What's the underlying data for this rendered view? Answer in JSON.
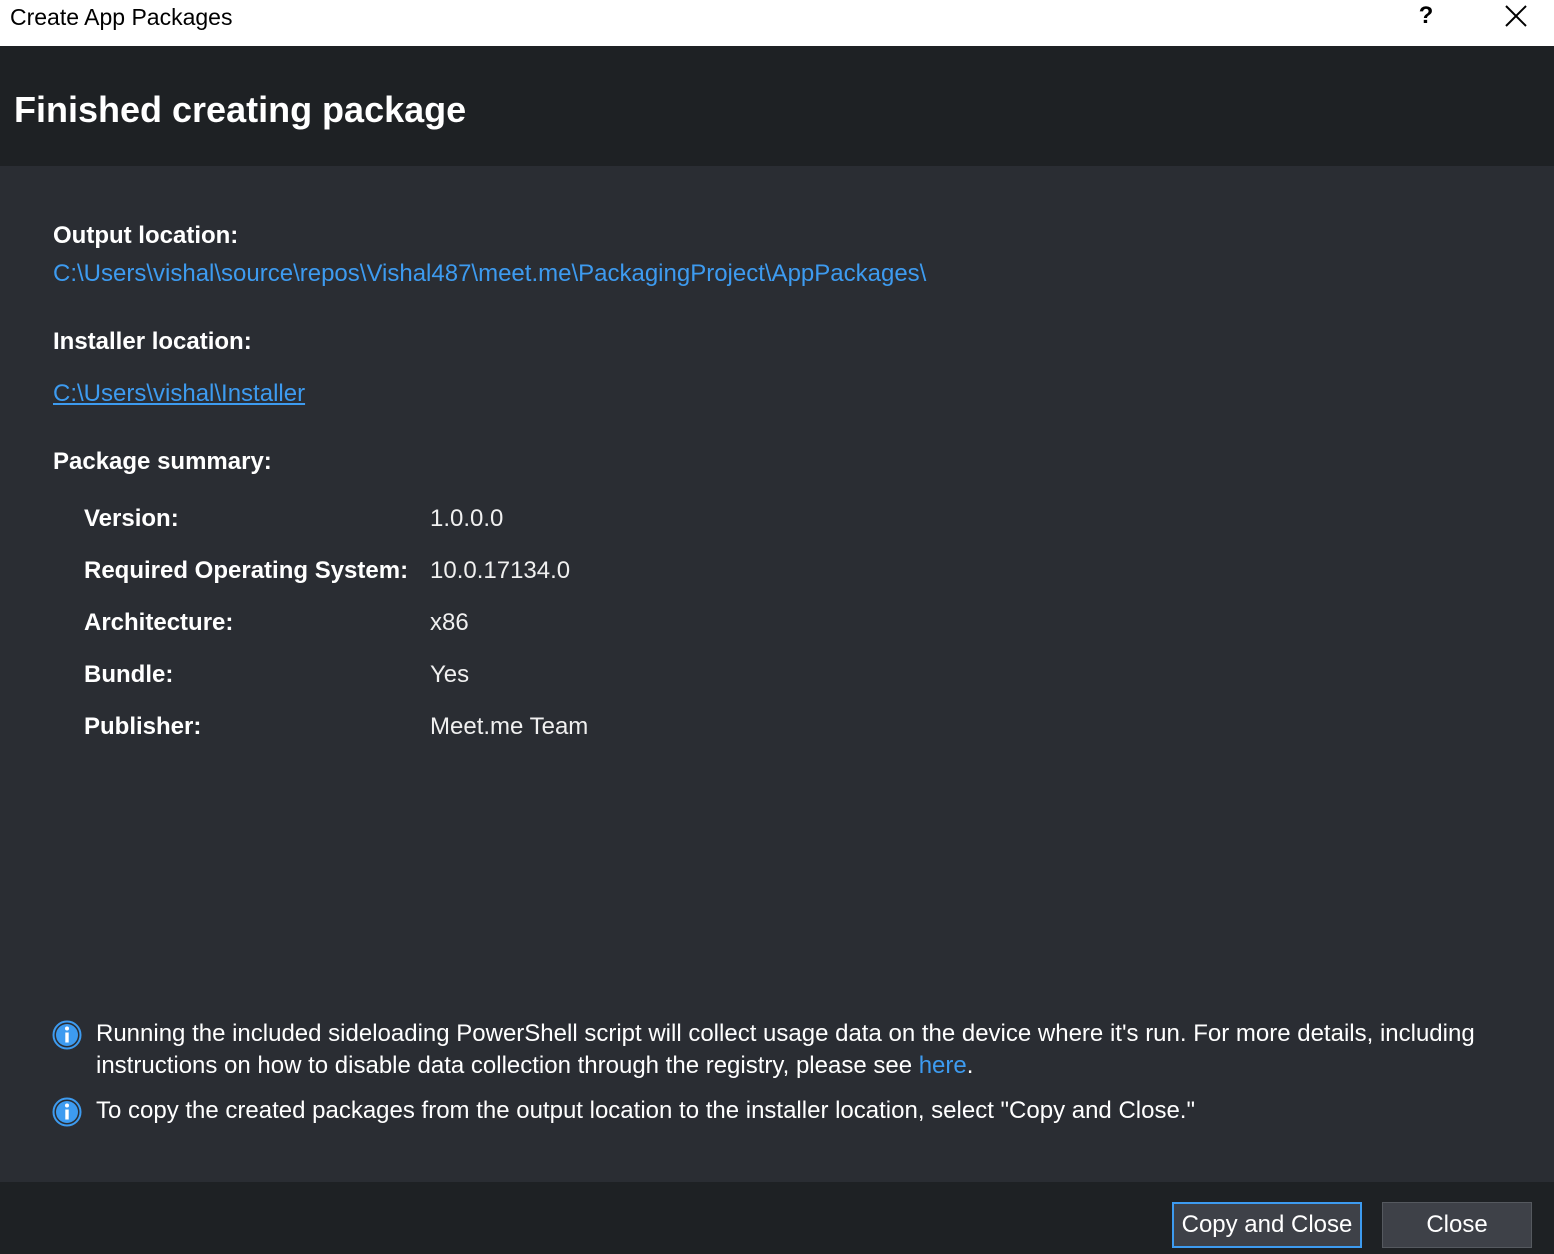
{
  "window": {
    "title": "Create App Packages",
    "help_label": "?",
    "close_icon": "close-icon"
  },
  "header": {
    "title": "Finished creating package"
  },
  "output": {
    "label": "Output location:",
    "path": "C:\\Users\\vishal\\source\\repos\\Vishal487\\meet.me\\PackagingProject\\AppPackages\\"
  },
  "installer": {
    "label": "Installer location:",
    "path": "C:\\Users\\vishal\\Installer"
  },
  "summary": {
    "label": "Package summary:",
    "rows": [
      {
        "key": "Version:",
        "value": "1.0.0.0"
      },
      {
        "key": "Required Operating System:",
        "value": "10.0.17134.0"
      },
      {
        "key": "Architecture:",
        "value": "x86"
      },
      {
        "key": "Bundle:",
        "value": "Yes"
      },
      {
        "key": "Publisher:",
        "value": "Meet.me Team"
      }
    ]
  },
  "notices": {
    "usage_text": "Running the included sideloading PowerShell script will collect usage data on the device where it's run.  For more details, including instructions on how to disable data collection through the registry, please see ",
    "usage_link": "here",
    "usage_end": ".",
    "copy_text": "To copy the created packages from the output location to the installer location, select \"Copy and Close.\""
  },
  "footer": {
    "copy_close_label": "Copy and Close",
    "close_label": "Close"
  },
  "colors": {
    "link": "#3d9bf0",
    "header_bg": "#1e2124",
    "content_bg": "#2a2d33",
    "info_icon": "#3d9bf0"
  }
}
